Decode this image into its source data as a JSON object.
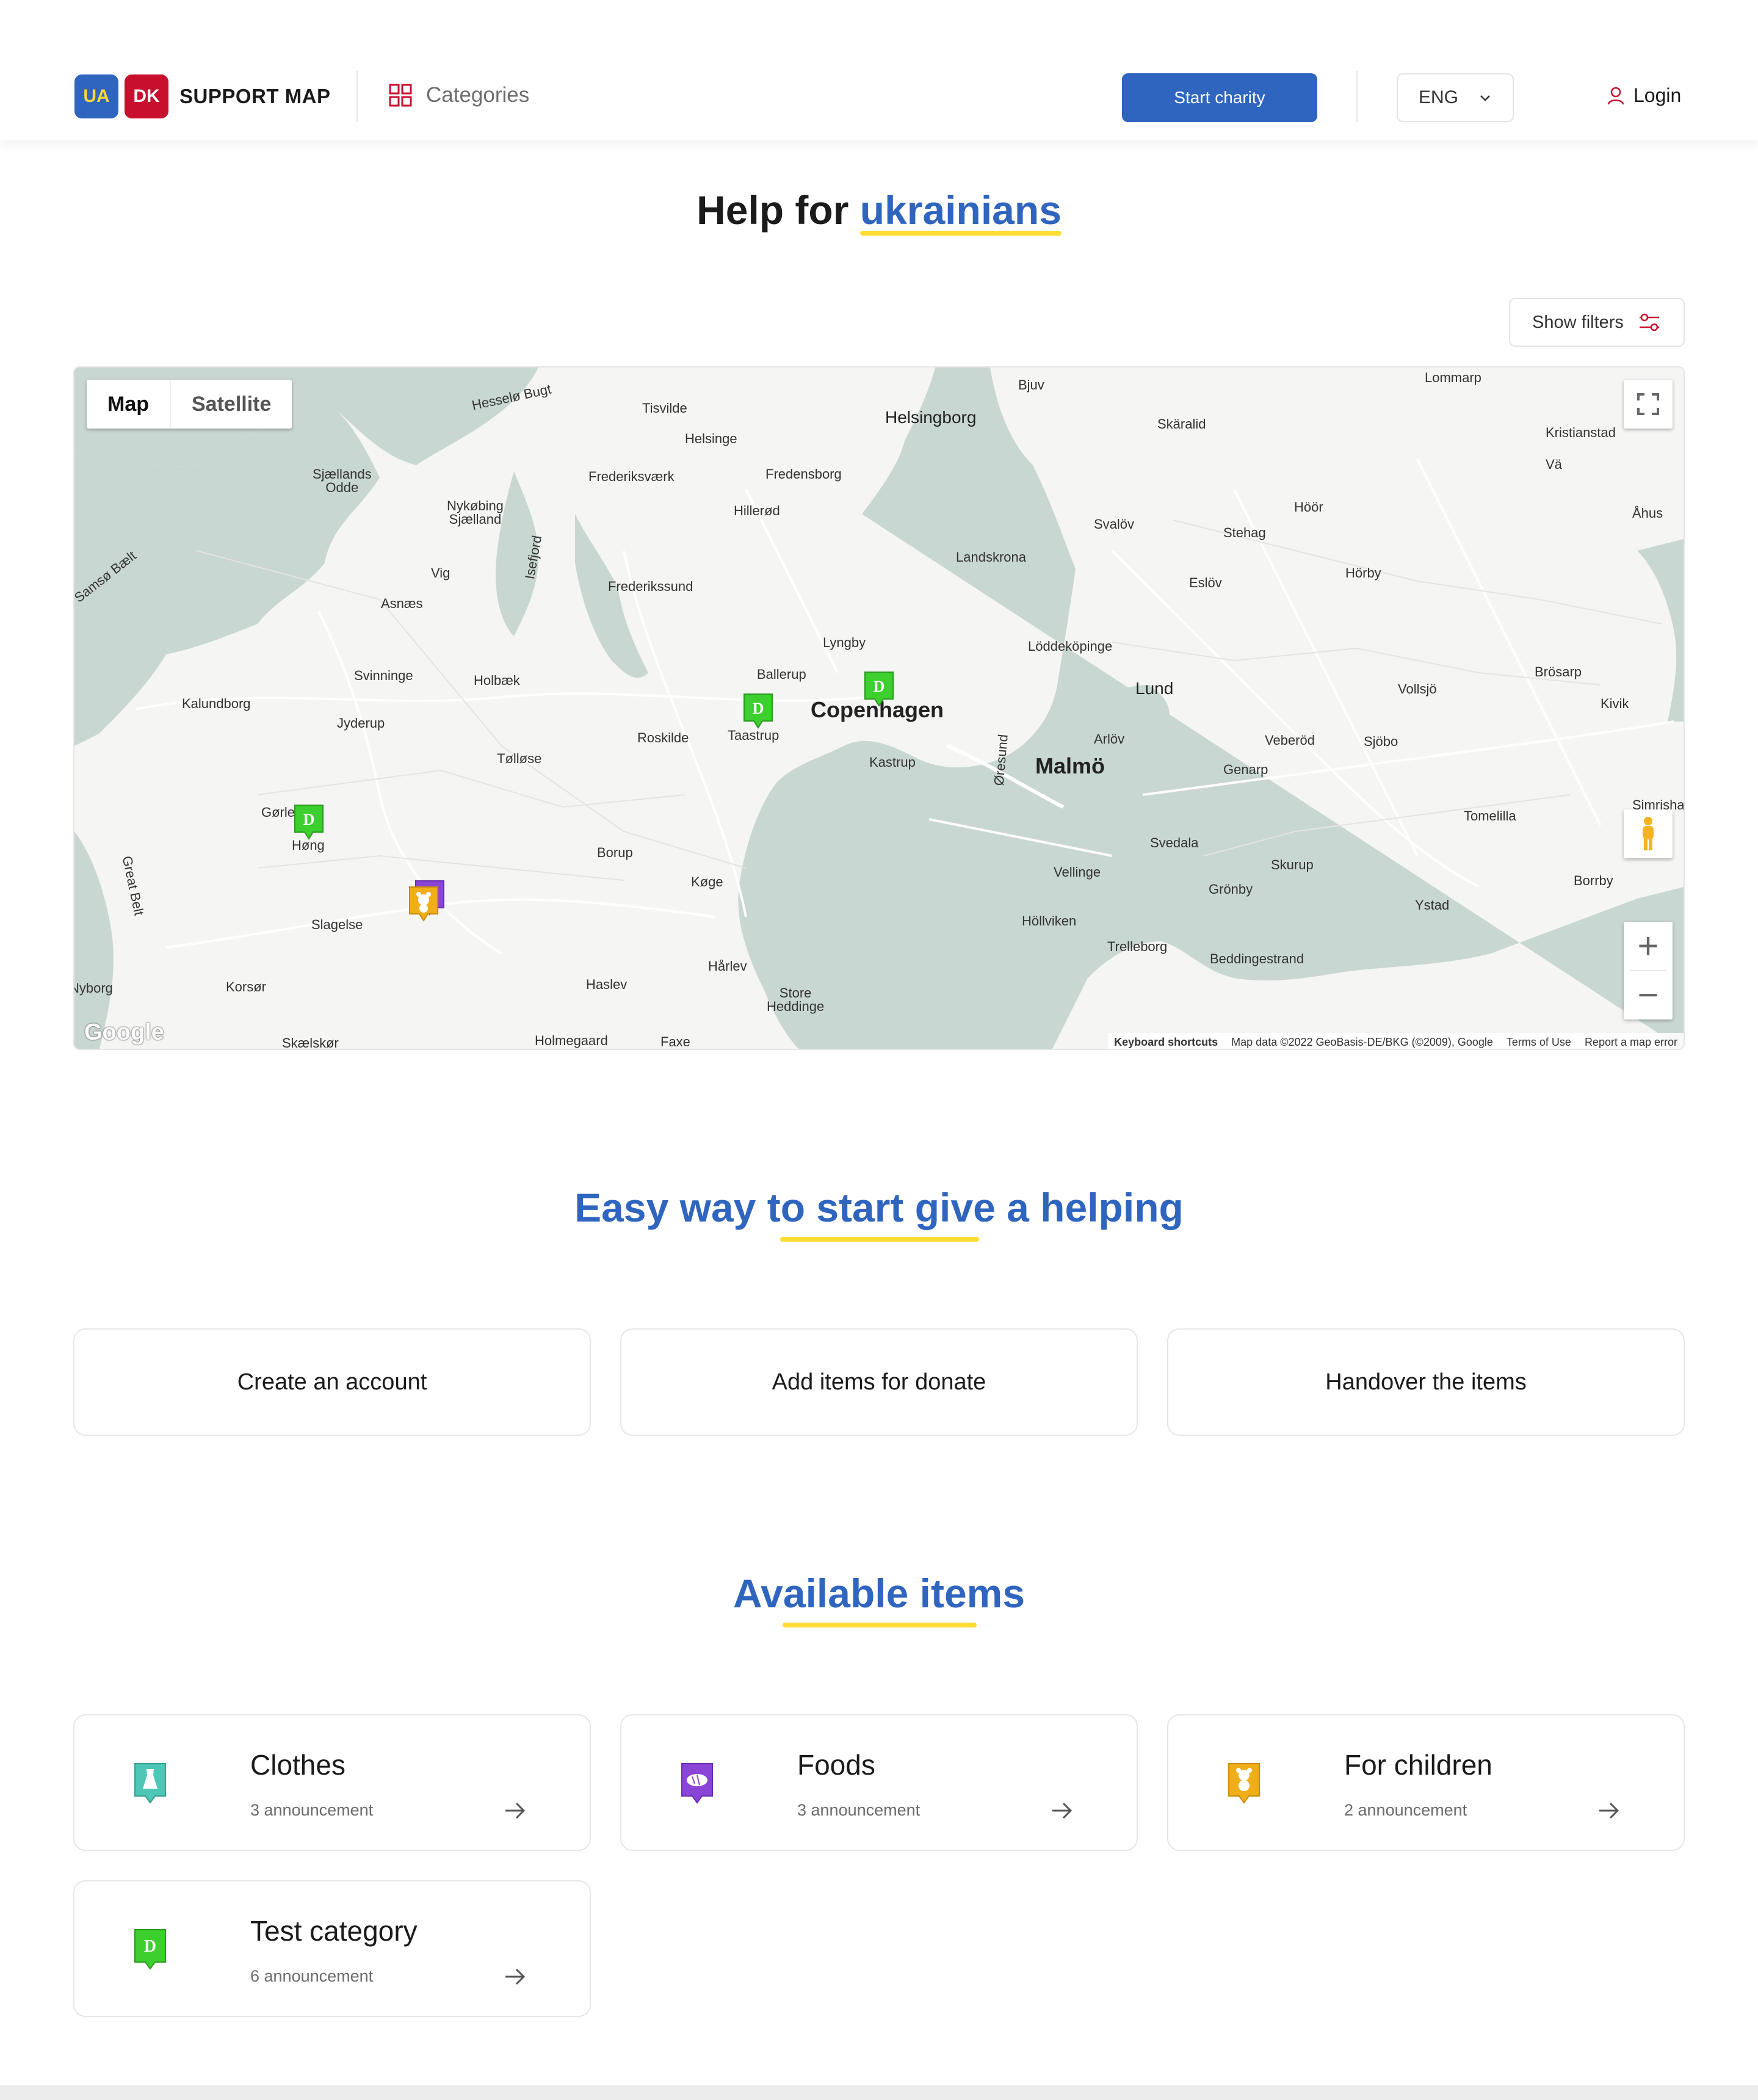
{
  "header": {
    "logo_ua": "UA",
    "logo_dk": "DK",
    "logo_text": "SUPPORT MAP",
    "categories_label": "Categories",
    "start_charity_label": "Start charity",
    "language": "ENG",
    "login_label": "Login"
  },
  "hero": {
    "title_prefix": "Help for",
    "title_accent": "ukrainians",
    "show_filters_label": "Show filters"
  },
  "map": {
    "toggle_map": "Map",
    "toggle_satellite": "Satellite",
    "google_label": "Google",
    "attribution": {
      "keyboard": "Keyboard shortcuts",
      "data": "Map data ©2022 GeoBasis-DE/BKG (©2009), Google",
      "terms": "Terms of Use",
      "report": "Report a map error"
    },
    "places": {
      "copenhagen": "Copenhagen",
      "malmo": "Malmö",
      "helsingborg": "Helsingborg",
      "lund": "Lund",
      "helsinge": "Helsinge",
      "tisvilde": "Tisvilde",
      "hillerod": "Hillerød",
      "fredensborg": "Fredensborg",
      "frederiksvaerk": "Frederiksværk",
      "frederikssund": "Frederikssund",
      "lyngby": "Lyngby",
      "ballerup": "Ballerup",
      "taastrup": "Taastrup",
      "roskilde": "Roskilde",
      "kastrup": "Kastrup",
      "koge": "Køge",
      "holbaek": "Holbæk",
      "tollose": "Tølløse",
      "kalundborg": "Kalundborg",
      "jyderup": "Jyderup",
      "svinninge": "Svinninge",
      "asnaes": "Asnæs",
      "vig": "Vig",
      "nykobing": "Nykøbing\nSjælland",
      "sjaellands_odde": "Sjællands\nOdde",
      "gorlev": "Gørlev",
      "hong": "Høng",
      "slagelse": "Slagelse",
      "korsor": "Korsør",
      "nyborg": "Nyborg",
      "skaelskor": "Skælskør",
      "borup": "Borup",
      "haslev": "Haslev",
      "harlev": "Hårlev",
      "store_heddinge": "Store\nHeddinge",
      "holmegaard": "Holmegaard",
      "faxe": "Faxe",
      "landskrona": "Landskrona",
      "bjuv": "Bjuv",
      "skaralid": "Skäralid",
      "svalov": "Svalöv",
      "lomma": "Löddeköpinge",
      "arlov": "Arlöv",
      "vellinge": "Vellinge",
      "hollviken": "Höllviken",
      "trelleborg": "Trelleborg",
      "svedala": "Svedala",
      "genarp": "Genarp",
      "veberod": "Veberöd",
      "sjobo": "Sjöbo",
      "vollsjo": "Vollsjö",
      "eslov": "Eslöv",
      "stehag": "Stehag",
      "hoor": "Höör",
      "horby": "Hörby",
      "lommarp": "Lommarp",
      "kristianstad": "Kristianstad",
      "va": "Vä",
      "ahus": "Åhus",
      "brosarp": "Brösarp",
      "kivik": "Kivik",
      "simrisha": "Simrisha",
      "tomelilla": "Tomelilla",
      "skurup": "Skurup",
      "gronby": "Grönby",
      "ystad": "Ystad",
      "borrby": "Borrby",
      "beddingestrand": "Beddingestrand"
    },
    "water": {
      "hesselo": "Hesselø Bugt",
      "samso": "Samsø Bælt",
      "storebaelt": "Great Belt",
      "isefjord": "Isefjord",
      "oresund": "Øresund"
    },
    "markers": [
      {
        "category": "Test category",
        "letter": "D",
        "color": "#3ccf2e"
      },
      {
        "category": "Test category",
        "letter": "D",
        "color": "#3ccf2e"
      },
      {
        "category": "Test category",
        "letter": "D",
        "color": "#3ccf2e"
      },
      {
        "category": "For children",
        "color": "#f1ae1b"
      },
      {
        "category": "Foods",
        "color": "#8a45d6"
      }
    ]
  },
  "steps": {
    "title": "Easy way to start give a helping",
    "items": [
      "Create an account",
      "Add items for donate",
      "Handover the items"
    ]
  },
  "available": {
    "title": "Available items",
    "items": [
      {
        "name": "Clothes",
        "count": "3 announcement",
        "icon": "dress-icon",
        "color": "#4ec7b7"
      },
      {
        "name": "Foods",
        "count": "3 announcement",
        "icon": "bread-icon",
        "color": "#8a45d6"
      },
      {
        "name": "For children",
        "count": "2 announcement",
        "icon": "teddy-bear-icon",
        "color": "#f1ae1b"
      },
      {
        "name": "Test category",
        "count": "6 announcement",
        "icon": "letter-d-icon",
        "color": "#3ccf2e"
      }
    ]
  },
  "colors": {
    "brand_blue": "#2f65bf",
    "accent_yellow": "#ffdd33",
    "flag_red": "#c8102e"
  }
}
